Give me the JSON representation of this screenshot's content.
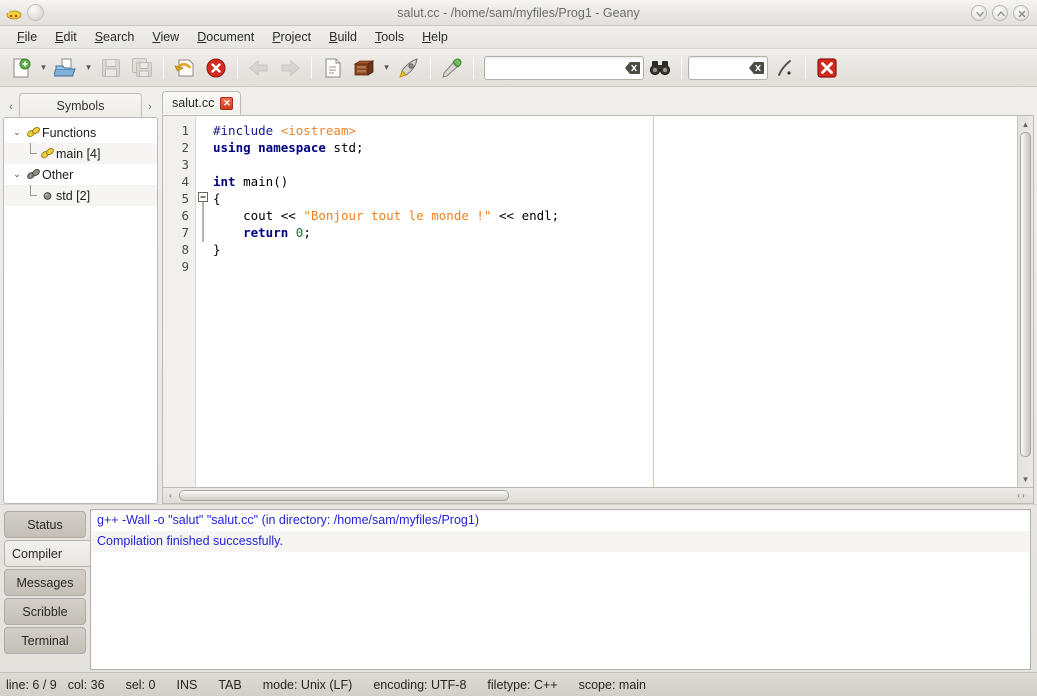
{
  "window": {
    "title": "salut.cc - /home/sam/myfiles/Prog1 - Geany",
    "app_icon": "geany-lamp-icon",
    "controls": {
      "minimize": "minimize-button",
      "maximize": "maximize-button",
      "close": "close-button"
    }
  },
  "menubar": {
    "items": [
      {
        "label": "File",
        "mnemonic": "F"
      },
      {
        "label": "Edit",
        "mnemonic": "E"
      },
      {
        "label": "Search",
        "mnemonic": "S"
      },
      {
        "label": "View",
        "mnemonic": "V"
      },
      {
        "label": "Document",
        "mnemonic": "D"
      },
      {
        "label": "Project",
        "mnemonic": "P"
      },
      {
        "label": "Build",
        "mnemonic": "B"
      },
      {
        "label": "Tools",
        "mnemonic": "T"
      },
      {
        "label": "Help",
        "mnemonic": "H"
      }
    ]
  },
  "toolbar": {
    "buttons": [
      {
        "name": "new-document-button",
        "icon": "new-file-icon",
        "enabled": true
      },
      {
        "name": "open-document-button",
        "icon": "open-folder-icon",
        "enabled": true
      },
      {
        "name": "save-button",
        "icon": "save-floppy-icon",
        "enabled": false
      },
      {
        "name": "save-all-button",
        "icon": "save-all-icon",
        "enabled": false
      },
      {
        "name": "revert-button",
        "icon": "undo-arrow-icon",
        "enabled": true
      },
      {
        "name": "close-document-button",
        "icon": "close-circle-icon",
        "enabled": true
      },
      {
        "name": "navigate-back-button",
        "icon": "arrow-left-icon",
        "enabled": false
      },
      {
        "name": "navigate-forward-button",
        "icon": "arrow-right-icon",
        "enabled": false
      },
      {
        "name": "compile-button",
        "icon": "compile-page-icon",
        "enabled": true
      },
      {
        "name": "build-button",
        "icon": "build-brick-icon",
        "enabled": true
      },
      {
        "name": "run-button",
        "icon": "run-rocket-icon",
        "enabled": true
      },
      {
        "name": "color-chooser-button",
        "icon": "color-picker-icon",
        "enabled": true
      },
      {
        "name": "find-button",
        "icon": "binoculars-icon",
        "enabled": true
      },
      {
        "name": "goto-line-button",
        "icon": "goto-line-icon",
        "enabled": true
      },
      {
        "name": "quit-button",
        "icon": "quit-x-icon",
        "enabled": true
      }
    ],
    "search_entry": {
      "value": "",
      "placeholder": ""
    },
    "goto_entry": {
      "value": "",
      "placeholder": ""
    }
  },
  "sidebar": {
    "tab_label": "Symbols",
    "prev_arrow": "chevron-left-icon",
    "next_arrow": "chevron-right-icon",
    "tree": [
      {
        "label": "Functions",
        "icon": "function-chain-icon",
        "level": 0,
        "expanded": true
      },
      {
        "label": "main [4]",
        "icon": "function-chain-icon",
        "level": 1,
        "expanded": false
      },
      {
        "label": "Other",
        "icon": "other-chain-icon",
        "level": 0,
        "expanded": true
      },
      {
        "label": "std [2]",
        "icon": "namespace-dot-icon",
        "level": 1,
        "expanded": false
      }
    ]
  },
  "editor": {
    "tab": {
      "label": "salut.cc",
      "close_icon": "tab-close-icon"
    },
    "line_numbers": [
      "1",
      "2",
      "3",
      "4",
      "5",
      "6",
      "7",
      "8",
      "9"
    ],
    "lines": [
      {
        "n": 1,
        "tokens": [
          {
            "t": "#include ",
            "c": "k-pre"
          },
          {
            "t": "<iostream>",
            "c": "k-hdr"
          }
        ]
      },
      {
        "n": 2,
        "tokens": [
          {
            "t": "using namespace ",
            "c": "k-kw"
          },
          {
            "t": "std;",
            "c": "k-txt"
          }
        ]
      },
      {
        "n": 3,
        "tokens": [
          {
            "t": "",
            "c": "k-txt"
          }
        ]
      },
      {
        "n": 4,
        "tokens": [
          {
            "t": "int ",
            "c": "k-type"
          },
          {
            "t": "main()",
            "c": "k-txt"
          }
        ]
      },
      {
        "n": 5,
        "tokens": [
          {
            "t": "{",
            "c": "k-txt"
          }
        ]
      },
      {
        "n": 6,
        "tokens": [
          {
            "t": "    cout << ",
            "c": "k-txt"
          },
          {
            "t": "\"Bonjour tout le monde !\"",
            "c": "k-str"
          },
          {
            "t": " << endl;",
            "c": "k-txt"
          }
        ]
      },
      {
        "n": 7,
        "tokens": [
          {
            "t": "    ",
            "c": "k-txt"
          },
          {
            "t": "return ",
            "c": "k-kw"
          },
          {
            "t": "0",
            "c": "k-num"
          },
          {
            "t": ";",
            "c": "k-txt"
          }
        ]
      },
      {
        "n": 8,
        "tokens": [
          {
            "t": "}",
            "c": "k-txt"
          }
        ]
      },
      {
        "n": 9,
        "tokens": [
          {
            "t": "",
            "c": "k-txt"
          }
        ]
      }
    ],
    "fold_marker_line": 5,
    "margin_column_color": "#b6dfb6"
  },
  "message_window": {
    "tabs": [
      {
        "label": "Status",
        "active": false
      },
      {
        "label": "Compiler",
        "active": true
      },
      {
        "label": "Messages",
        "active": false
      },
      {
        "label": "Scribble",
        "active": false
      },
      {
        "label": "Terminal",
        "active": false
      }
    ],
    "compiler_output": [
      "g++ -Wall -o \"salut\" \"salut.cc\" (in directory: /home/sam/myfiles/Prog1)",
      "Compilation finished successfully."
    ],
    "output_color": "#2323d8"
  },
  "statusbar": {
    "line": "line: 6 / 9",
    "col": "col: 36",
    "sel": "sel: 0",
    "overwrite": "INS",
    "indent": "TAB",
    "mode": "mode: Unix (LF)",
    "encoding": "encoding: UTF-8",
    "filetype": "filetype: C++",
    "scope": "scope: main"
  }
}
